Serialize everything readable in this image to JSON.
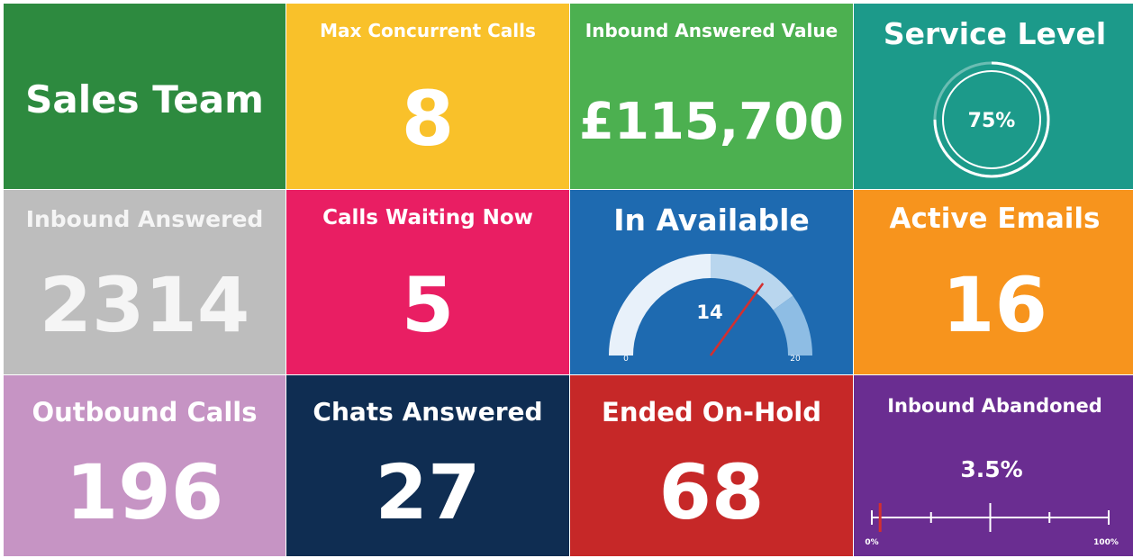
{
  "tiles": {
    "sales_team": {
      "title": "Sales Team",
      "bg": "#2d8a3f"
    },
    "max_concurrent": {
      "title": "Max Concurrent Calls",
      "value": "8",
      "bg": "#f9c12a"
    },
    "inbound_value": {
      "title": "Inbound Answered Value",
      "value": "£115,700",
      "bg": "#4cb050"
    },
    "service_level": {
      "title": "Service Level",
      "value": "75%",
      "percent": 75,
      "bg": "#1c9a8a"
    },
    "inbound_answered": {
      "title": "Inbound Answered",
      "value": "2314",
      "bg": "#bdbdbd"
    },
    "calls_waiting": {
      "title": "Calls Waiting Now",
      "value": "5",
      "bg": "#e91e63"
    },
    "in_available": {
      "title": "In Available",
      "value": "14",
      "min": "0",
      "max": "20",
      "bg": "#1e6ab0"
    },
    "active_emails": {
      "title": "Active Emails",
      "value": "16",
      "bg": "#f7941d"
    },
    "outbound_calls": {
      "title": "Outbound Calls",
      "value": "196",
      "bg": "#c694c4"
    },
    "chats_answered": {
      "title": "Chats Answered",
      "value": "27",
      "bg": "#0f2d52"
    },
    "ended_on_hold": {
      "title": "Ended On-Hold",
      "value": "68",
      "bg": "#c62828"
    },
    "inbound_abandoned": {
      "title": "Inbound Abandoned",
      "value": "3.5%",
      "percent": 3.5,
      "min": "0%",
      "max": "100%",
      "bg": "#6a2d91"
    }
  },
  "colors": {
    "needle": "#d32f2f",
    "gauge_light": "#e8f1fa",
    "gauge_mid": "#b9d6ee",
    "gauge_dark": "#8ebde4"
  }
}
